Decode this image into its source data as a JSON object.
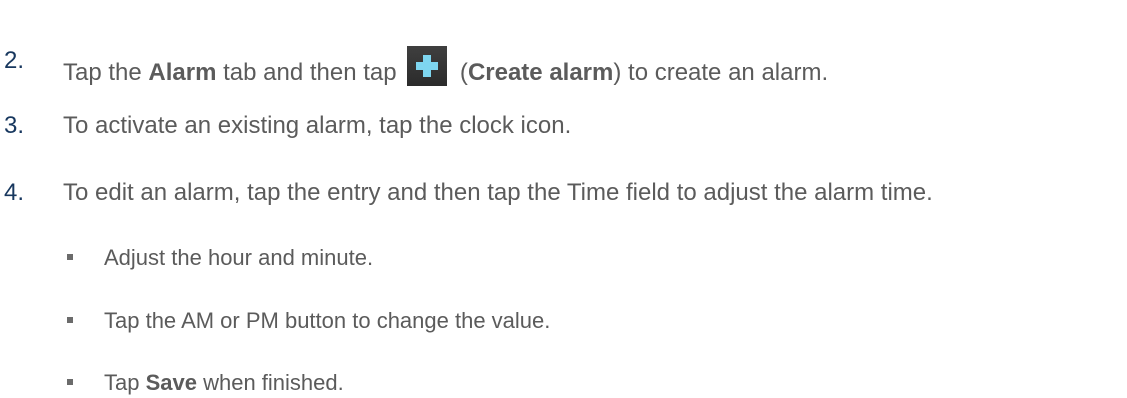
{
  "steps": [
    {
      "number": "2.",
      "pre": "Tap the ",
      "bold1": "Alarm",
      "mid": " tab and then tap ",
      "icon": "plus-icon",
      "paren_open": " (",
      "bold2": "Create alarm",
      "post": ") to create an alarm."
    },
    {
      "number": "3.",
      "text": "To activate an existing alarm, tap the clock icon."
    },
    {
      "number": "4.",
      "text": "To edit an alarm, tap the entry and then tap the Time field to adjust the alarm time."
    }
  ],
  "bullets": [
    {
      "text": "Adjust the hour and minute."
    },
    {
      "text": "Tap the AM or PM button to change the value."
    },
    {
      "pre": "Tap ",
      "bold": "Save",
      "post": " when finished."
    }
  ],
  "colors": {
    "step_number": "#17375e",
    "body_text": "#5b5b5b",
    "icon_background": "#333333",
    "icon_plus": "#7ed6f0"
  }
}
